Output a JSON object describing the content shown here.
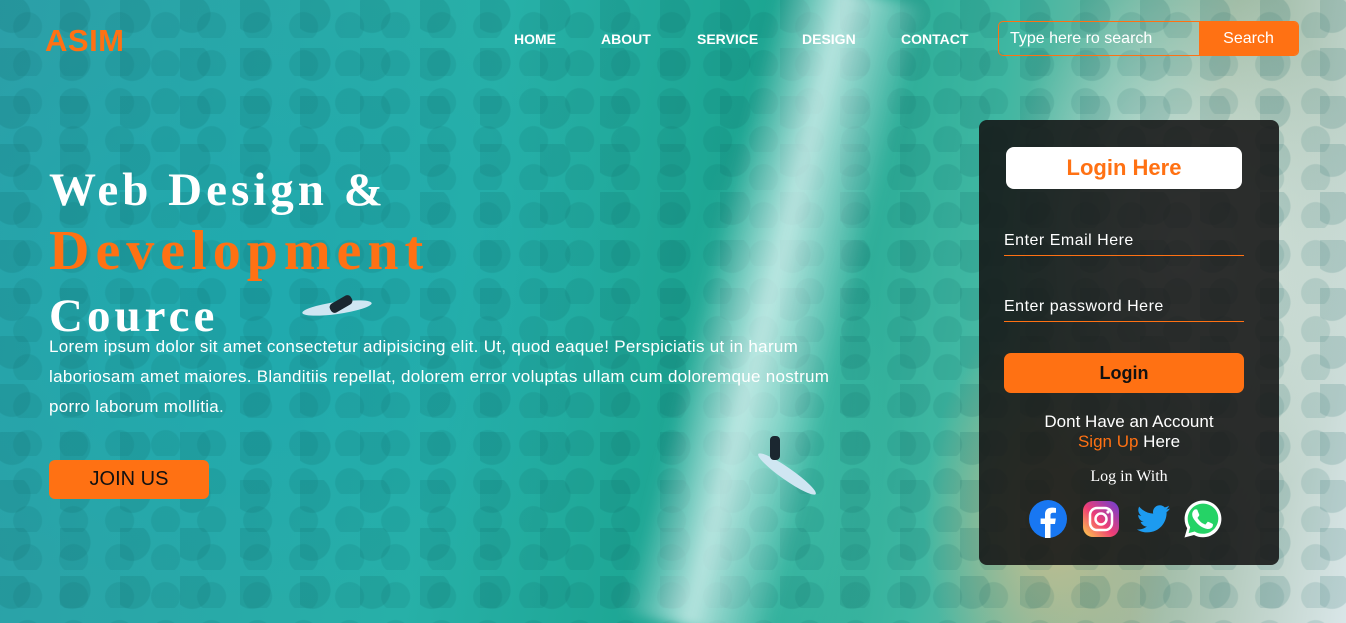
{
  "brand": {
    "logo": "ASIM"
  },
  "nav": {
    "items": [
      "HOME",
      "ABOUT",
      "SERVICE",
      "DESIGN",
      "CONTACT"
    ]
  },
  "search": {
    "placeholder": "Type here ro search",
    "button": "Search"
  },
  "hero": {
    "line1": "Web Design &",
    "line2": "Development",
    "line3": "Cource",
    "paragraph": "Lorem ipsum dolor sit amet consectetur adipisicing elit. Ut, quod eaque! Perspiciatis ut in harum laboriosam amet maiores. Blanditiis repellat, dolorem error voluptas ullam cum doloremque nostrum porro laborum mollitia.",
    "cta": "JOIN US"
  },
  "login": {
    "title": "Login Here",
    "email_placeholder": "Enter Email Here",
    "password_placeholder": "Enter password Here",
    "button": "Login",
    "account_text": "Dont Have an Account",
    "signup_link": "Sign Up",
    "signup_suffix": " Here",
    "login_with": "Log in With",
    "socials": [
      "facebook-icon",
      "instagram-icon",
      "twitter-icon",
      "whatsapp-icon"
    ]
  },
  "colors": {
    "accent": "#ff7113",
    "panel": "#141414",
    "text": "#ffffff"
  }
}
